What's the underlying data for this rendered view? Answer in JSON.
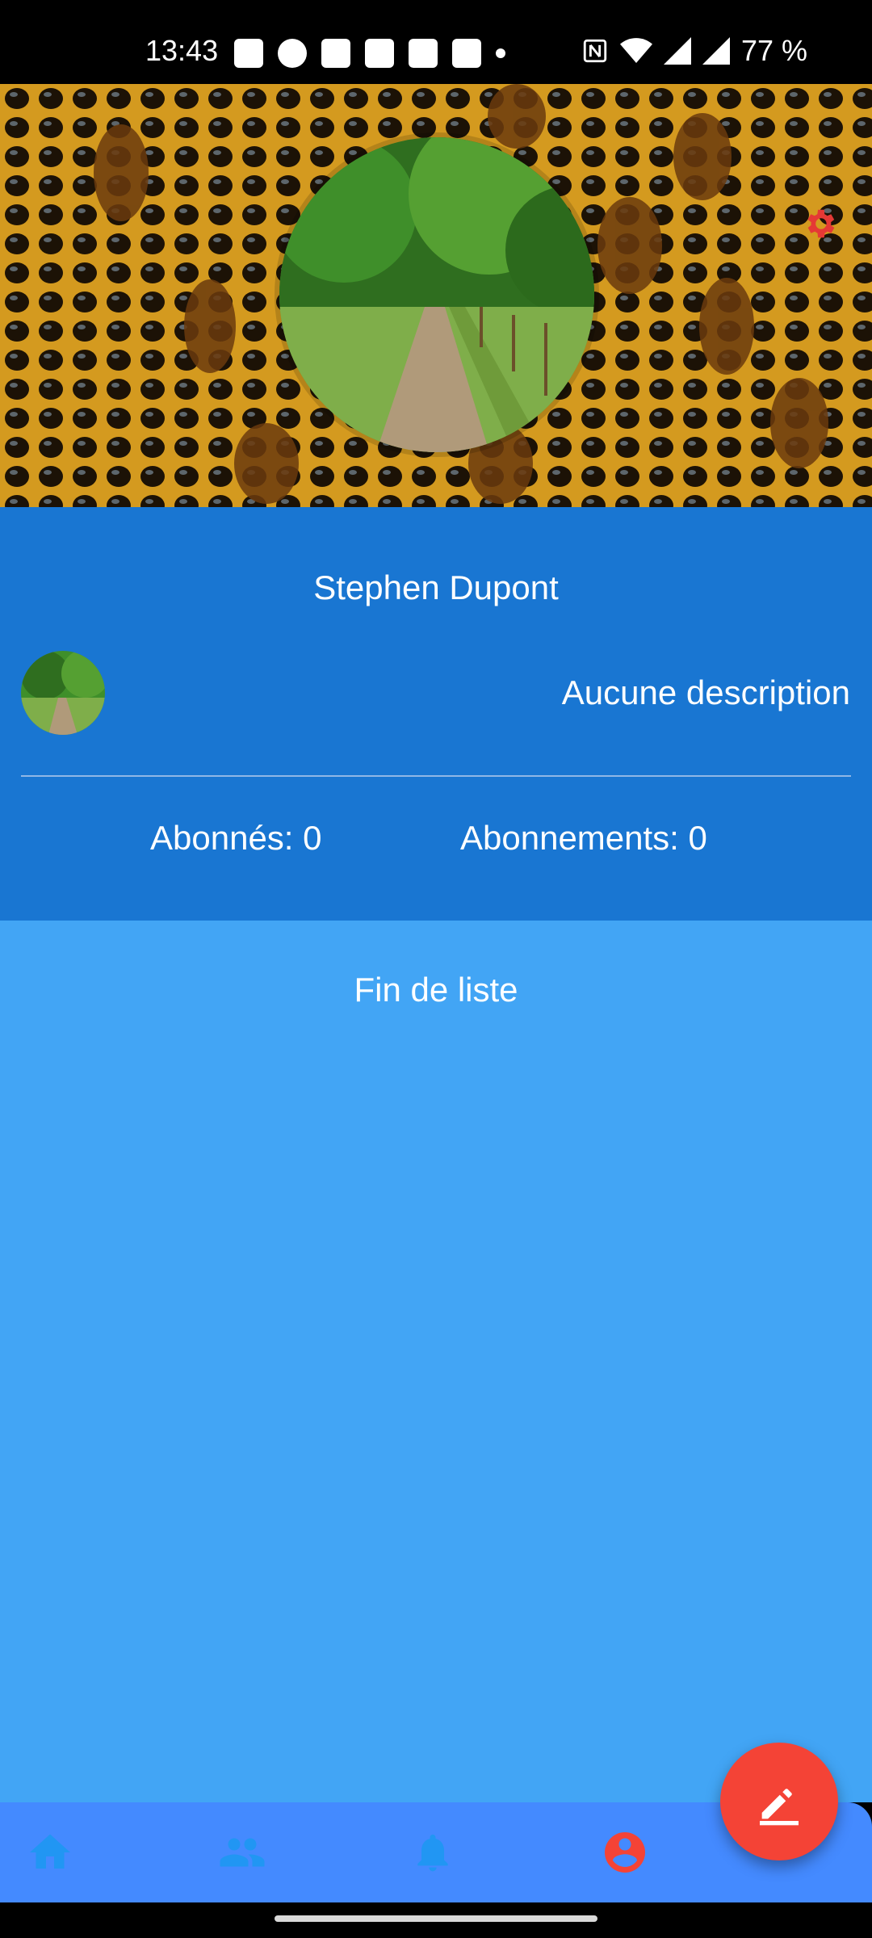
{
  "status_bar": {
    "time": "13:43",
    "battery_text": "77 %"
  },
  "cover": {
    "settings_icon": "gear-icon",
    "cover_color": "#d49a1f",
    "avatar_image": "forest-path"
  },
  "profile": {
    "name": "Stephen Dupont",
    "description": "Aucune description",
    "followers_label": "Abonnés: 0",
    "following_label": "Abonnements: 0",
    "background_color": "#1976d2"
  },
  "list": {
    "end_text": "Fin de liste",
    "background_color": "#42a5f5"
  },
  "bottom_nav": {
    "items": [
      {
        "icon": "home-icon",
        "active": false
      },
      {
        "icon": "people-icon",
        "active": false
      },
      {
        "icon": "bell-icon",
        "active": false
      },
      {
        "icon": "account-icon",
        "active": true
      }
    ],
    "active_color": "#f44336",
    "inactive_color": "#2196f3"
  },
  "fab": {
    "icon": "edit-icon",
    "color": "#f44336"
  }
}
